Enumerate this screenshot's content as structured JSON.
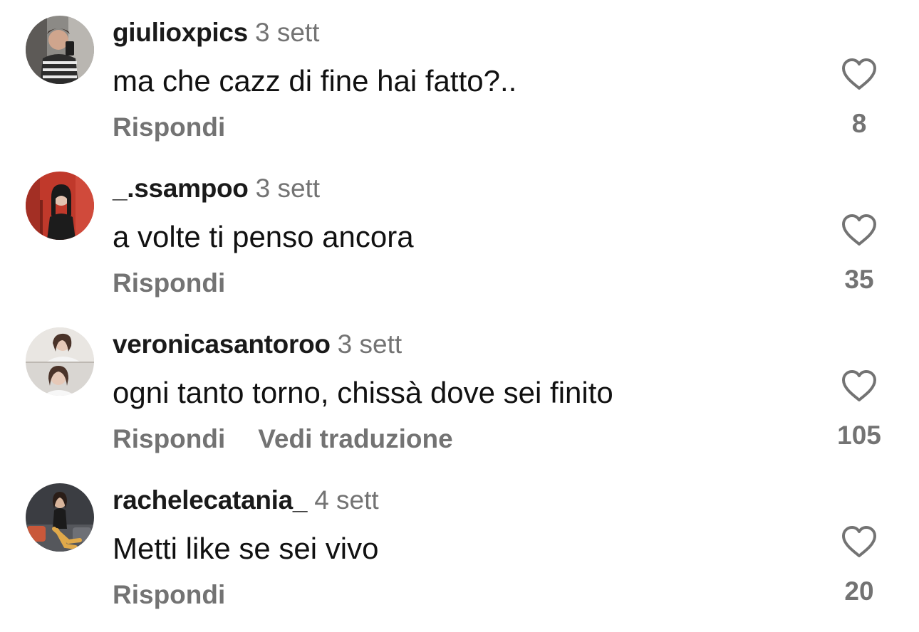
{
  "comments": [
    {
      "username": "giulioxpics",
      "time": "3 sett",
      "text": "ma che cazz di fine hai fatto?..",
      "reply_label": "Rispondi",
      "likes": "8"
    },
    {
      "username": "_.ssampoo",
      "time": "3 sett",
      "text": "a volte ti penso ancora",
      "reply_label": "Rispondi",
      "likes": "35"
    },
    {
      "username": "veronicasantoroo",
      "time": "3 sett",
      "text": "ogni tanto torno, chissà dove sei finito",
      "reply_label": "Rispondi",
      "translate_label": "Vedi traduzione",
      "likes": "105"
    },
    {
      "username": "rachelecatania_",
      "time": "4 sett",
      "text": "Metti like se sei vivo",
      "reply_label": "Rispondi",
      "likes": "20"
    }
  ],
  "icons": {
    "like": "heart-outline-icon"
  },
  "colors": {
    "text": "#111111",
    "secondary": "#737373",
    "background": "#ffffff"
  }
}
